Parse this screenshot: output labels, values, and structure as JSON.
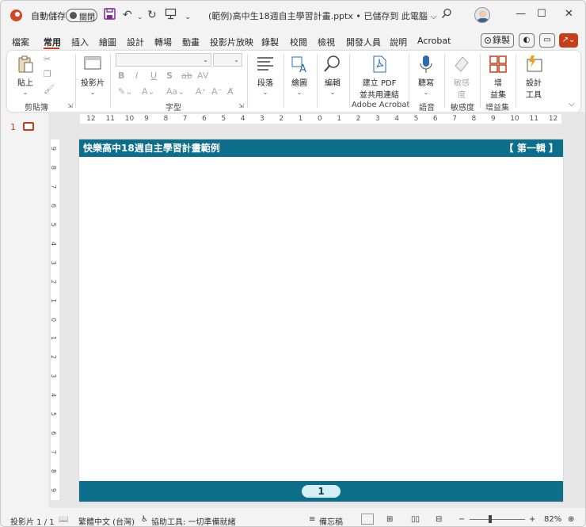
{
  "titlebar": {
    "autosave_label": "自動儲存",
    "autosave_state": "關閉",
    "document_title": "(範例)高中生18週自主學習計畫.pptx • 已儲存到 此電腦 ⌵",
    "more_label": "⌄",
    "minimize": "—",
    "maximize": "☐",
    "close": "✕"
  },
  "tabs": [
    "檔案",
    "常用",
    "插入",
    "繪圖",
    "設計",
    "轉場",
    "動畫",
    "投影片放映",
    "錄製",
    "校閱",
    "檢視",
    "開發人員",
    "說明",
    "Acrobat"
  ],
  "tab_actions": {
    "record_label": "錄製"
  },
  "ribbon": {
    "paste_label": "貼上",
    "slides_label": "投影片",
    "paragraph_label": "段落",
    "drawing_label": "繪圖",
    "editing_label": "編輯",
    "pdf_label_1": "建立 PDF",
    "pdf_label_2": "並共用連結",
    "dictate_label": "聽寫",
    "sensitivity_label_1": "敏感",
    "sensitivity_label_2": "度",
    "addins_label_1": "增",
    "addins_label_2": "益集",
    "designer_label_1": "設計",
    "designer_label_2": "工具",
    "groups": {
      "clipboard": "剪貼簿",
      "font": "字型",
      "adobe": "Adobe Acrobat",
      "voice": "語音",
      "sensitivity": "敏感度",
      "addins": "增益集"
    },
    "format_buttons": [
      "B",
      "I",
      "U",
      "S",
      "ab",
      "AV"
    ]
  },
  "slide_panel": {
    "number": "1"
  },
  "ruler": {
    "h_ticks": [
      "12",
      "11",
      "10",
      "9",
      "8",
      "7",
      "6",
      "5",
      "4",
      "3",
      "2",
      "1",
      "0",
      "1",
      "2",
      "3",
      "4",
      "5",
      "6",
      "7",
      "8",
      "9",
      "10",
      "11",
      "12"
    ],
    "v_ticks": [
      "9",
      "8",
      "7",
      "6",
      "5",
      "4",
      "3",
      "2",
      "1",
      "0",
      "1",
      "2",
      "3",
      "4",
      "5",
      "6",
      "7",
      "8",
      "9"
    ]
  },
  "slide": {
    "title": "快樂高中18週自主學習計畫範例",
    "edition": "【 第一輯 】",
    "page_number": "1",
    "brand_color": "#0d6e8c"
  },
  "statusbar": {
    "slide_info": "投影片 1 / 1",
    "language": "繁體中文 (台灣)",
    "accessibility": "協助工具: 一切準備就緒",
    "notes": "備忘稿",
    "zoom": "82%"
  }
}
